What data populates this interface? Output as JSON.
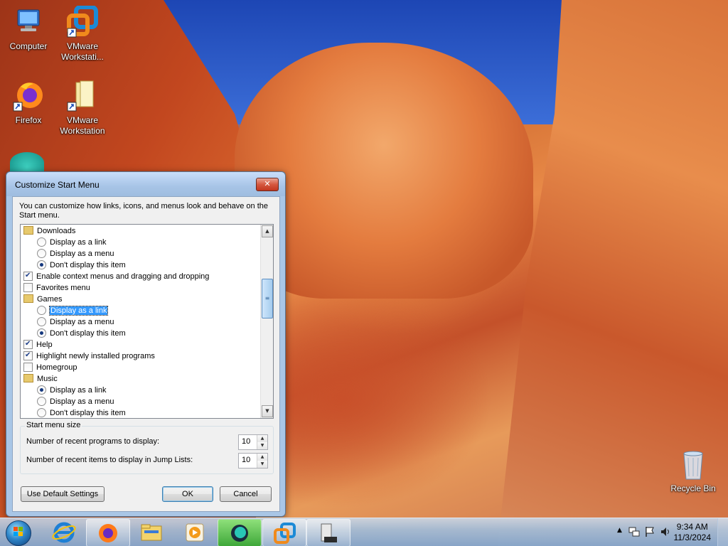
{
  "desktop": {
    "icons": [
      {
        "label": "Computer",
        "icon": "computer-icon"
      },
      {
        "label": "VMware Workstati...",
        "icon": "vmware-shortcut-icon"
      },
      {
        "label": "Firefox",
        "icon": "firefox-icon"
      },
      {
        "label": "VMware Workstation",
        "icon": "folder-icon"
      },
      {
        "label": "Recycle Bin",
        "icon": "recycle-bin-icon"
      }
    ]
  },
  "dialog": {
    "title": "Customize Start Menu",
    "close_label": "✕",
    "description": "You can customize how links, icons, and menus look and behave on the Start menu.",
    "items": [
      {
        "type": "header",
        "label": "Downloads",
        "icon": "downloads-folder-icon"
      },
      {
        "type": "radio",
        "label": "Display as a link",
        "checked": false
      },
      {
        "type": "radio",
        "label": "Display as a menu",
        "checked": false
      },
      {
        "type": "radio",
        "label": "Don't display this item",
        "checked": true
      },
      {
        "type": "checkbox",
        "label": "Enable context menus and dragging and dropping",
        "checked": true
      },
      {
        "type": "checkbox",
        "label": "Favorites menu",
        "checked": false
      },
      {
        "type": "header",
        "label": "Games",
        "icon": "games-icon"
      },
      {
        "type": "radio",
        "label": "Display as a link",
        "checked": false,
        "focused": true
      },
      {
        "type": "radio",
        "label": "Display as a menu",
        "checked": false
      },
      {
        "type": "radio",
        "label": "Don't display this item",
        "checked": true
      },
      {
        "type": "checkbox",
        "label": "Help",
        "checked": true
      },
      {
        "type": "checkbox",
        "label": "Highlight newly installed programs",
        "checked": true
      },
      {
        "type": "checkbox",
        "label": "Homegroup",
        "checked": false
      },
      {
        "type": "header",
        "label": "Music",
        "icon": "music-icon"
      },
      {
        "type": "radio",
        "label": "Display as a link",
        "checked": true
      },
      {
        "type": "radio",
        "label": "Display as a menu",
        "checked": false
      },
      {
        "type": "radio",
        "label": "Don't display this item",
        "checked": false
      }
    ],
    "size_group": {
      "legend": "Start menu size",
      "recent_programs_label": "Number of recent programs to display:",
      "recent_programs_value": "10",
      "jump_lists_label": "Number of recent items to display in Jump Lists:",
      "jump_lists_value": "10"
    },
    "buttons": {
      "defaults": "Use Default Settings",
      "ok": "OK",
      "cancel": "Cancel"
    }
  },
  "taskbar": {
    "start_icon": "windows-start-orb-icon",
    "pinned": [
      "internet-explorer-icon",
      "firefox-icon",
      "explorer-folder-icon",
      "media-player-icon",
      "app-icon",
      "vmware-icon",
      "server-manager-icon"
    ],
    "time": "9:34 AM",
    "date": "11/3/2024"
  }
}
